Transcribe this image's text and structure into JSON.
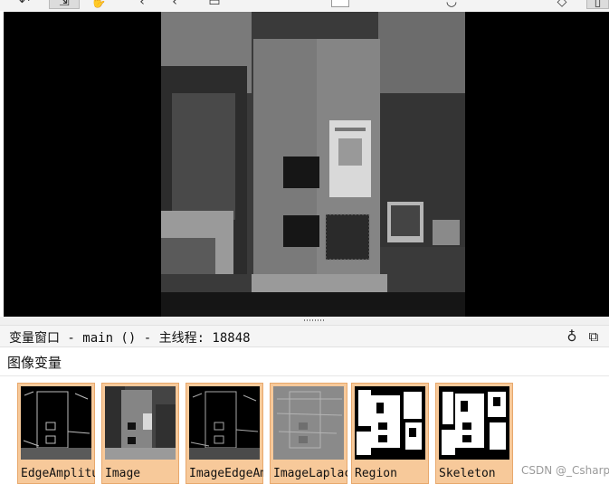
{
  "toolbar": {
    "icons": [
      "undo-icon",
      "pointer-icon",
      "hand-icon",
      "zoom-in-icon",
      "zoom-out-icon",
      "window-icon",
      "search-box",
      "lasso-icon",
      "diamond-icon",
      "copy-icon"
    ]
  },
  "var_window": {
    "title": "变量窗口 - main () - 主线程: 18848",
    "section_title": "图像变量",
    "pin_glyph": "♁",
    "restore_glyph": "⧉",
    "tiles": [
      {
        "label": "EdgeAmplitude",
        "kind": "edge"
      },
      {
        "label": "Image",
        "kind": "gray"
      },
      {
        "label": "ImageEdgeAmp",
        "kind": "edge"
      },
      {
        "label": "ImageLaplace",
        "kind": "laplace"
      },
      {
        "label": "Region",
        "kind": "region"
      },
      {
        "label": "Skeleton",
        "kind": "region"
      }
    ]
  },
  "watermark": "CSDN @_Csharp",
  "colors": {
    "tile_selected": "#f7c99a",
    "tile_border": "#e8a86c",
    "graphics_bg": "#000000"
  }
}
